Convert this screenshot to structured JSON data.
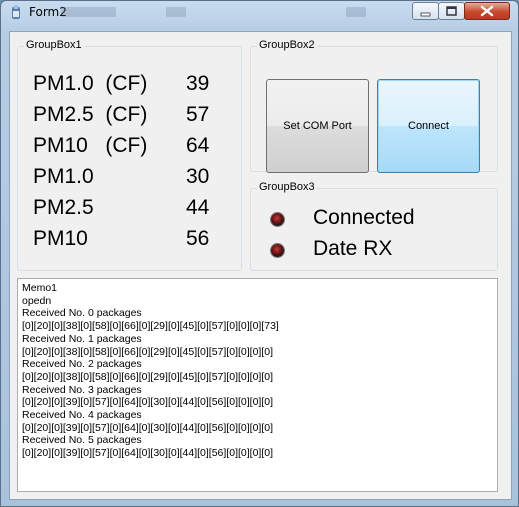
{
  "window": {
    "title": "Form2",
    "app_icon": "app-icon",
    "controls": [
      "minimize-icon",
      "maximize-icon",
      "close-icon"
    ]
  },
  "groupbox1": {
    "title": "GroupBox1",
    "rows": [
      {
        "label": "PM1.0  (CF)",
        "value": "39"
      },
      {
        "label": "PM2.5  (CF)",
        "value": "57"
      },
      {
        "label": "PM10   (CF)",
        "value": "64"
      },
      {
        "label": "PM1.0",
        "value": "30"
      },
      {
        "label": "PM2.5",
        "value": "44"
      },
      {
        "label": "PM10",
        "value": "56"
      }
    ]
  },
  "groupbox2": {
    "title": "GroupBox2",
    "set_com_port_label": "Set COM Port",
    "connect_label": "Connect"
  },
  "groupbox3": {
    "title": "GroupBox3",
    "indicators": [
      {
        "label": "Connected",
        "icon": "led-icon"
      },
      {
        "label": "Date RX",
        "icon": "led-icon"
      }
    ]
  },
  "memo": {
    "lines": [
      "Memo1",
      "opedn",
      "Received No. 0 packages",
      "[0][20][0][38][0][58][0][66][0][29][0][45][0][57][0][0][0][73]",
      "Received No. 1 packages",
      "[0][20][0][38][0][58][0][66][0][29][0][45][0][57][0][0][0][0]",
      "Received No. 2 packages",
      "[0][20][0][38][0][58][0][66][0][29][0][45][0][57][0][0][0][0]",
      "Received No. 3 packages",
      "[0][20][0][39][0][57][0][64][0][30][0][44][0][56][0][0][0][0]",
      "Received No. 4 packages",
      "[0][20][0][39][0][57][0][64][0][30][0][44][0][56][0][0][0][0]",
      "Received No. 5 packages",
      "[0][20][0][39][0][57][0][64][0][30][0][44][0][56][0][0][0][0]"
    ]
  },
  "colors": {
    "connect_accent": "#3c7fb1",
    "led": "#6a1010",
    "close_button": "#c9482f"
  }
}
